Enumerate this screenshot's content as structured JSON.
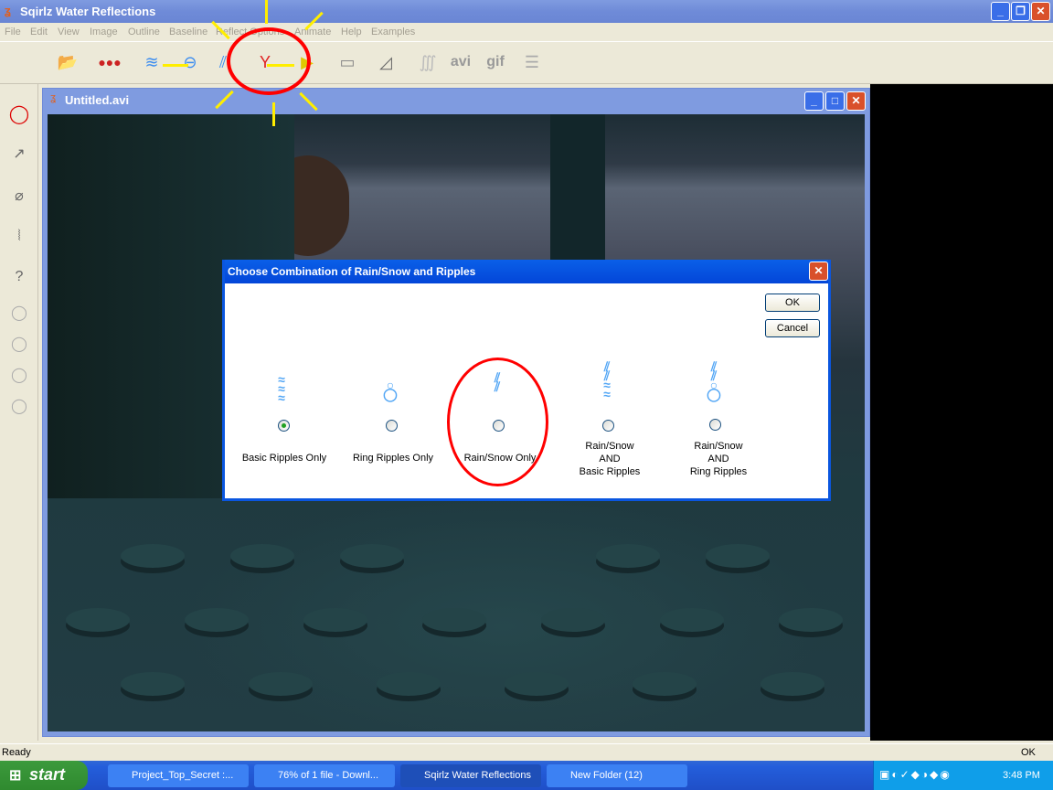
{
  "app": {
    "title": "Sqirlz Water Reflections"
  },
  "menu": [
    "File",
    "Edit",
    "View",
    "Image",
    "Outline",
    "Baseline",
    "Reflect Options",
    "Animate",
    "Help",
    "Examples"
  ],
  "toolbar": {
    "avi_label": "avi",
    "gif_label": "gif"
  },
  "child_window": {
    "title": "Untitled.avi"
  },
  "dialog": {
    "title": "Choose Combination of Rain/Snow and Ripples",
    "ok_label": "OK",
    "cancel_label": "Cancel",
    "options": [
      {
        "label": "Basic Ripples Only",
        "selected": true
      },
      {
        "label": "Ring Ripples Only",
        "selected": false
      },
      {
        "label": "Rain/Snow Only",
        "selected": false
      },
      {
        "label_lines": [
          "Rain/Snow",
          "AND",
          "Basic Ripples"
        ],
        "selected": false
      },
      {
        "label_lines": [
          "Rain/Snow",
          "AND",
          "Ring Ripples"
        ],
        "selected": false
      }
    ]
  },
  "status": {
    "left": "Ready",
    "right": "OK"
  },
  "taskbar": {
    "start_label": "start",
    "tasks": [
      "Project_Top_Secret :...",
      "76% of 1 file - Downl...",
      "Sqirlz Water Reflections",
      "New Folder (12)"
    ],
    "clock": "3:48 PM"
  },
  "colors": {
    "annotation_circle": "#ff0000",
    "annotation_rays": "#ffee00",
    "dialog_title": "#0a56e0"
  }
}
